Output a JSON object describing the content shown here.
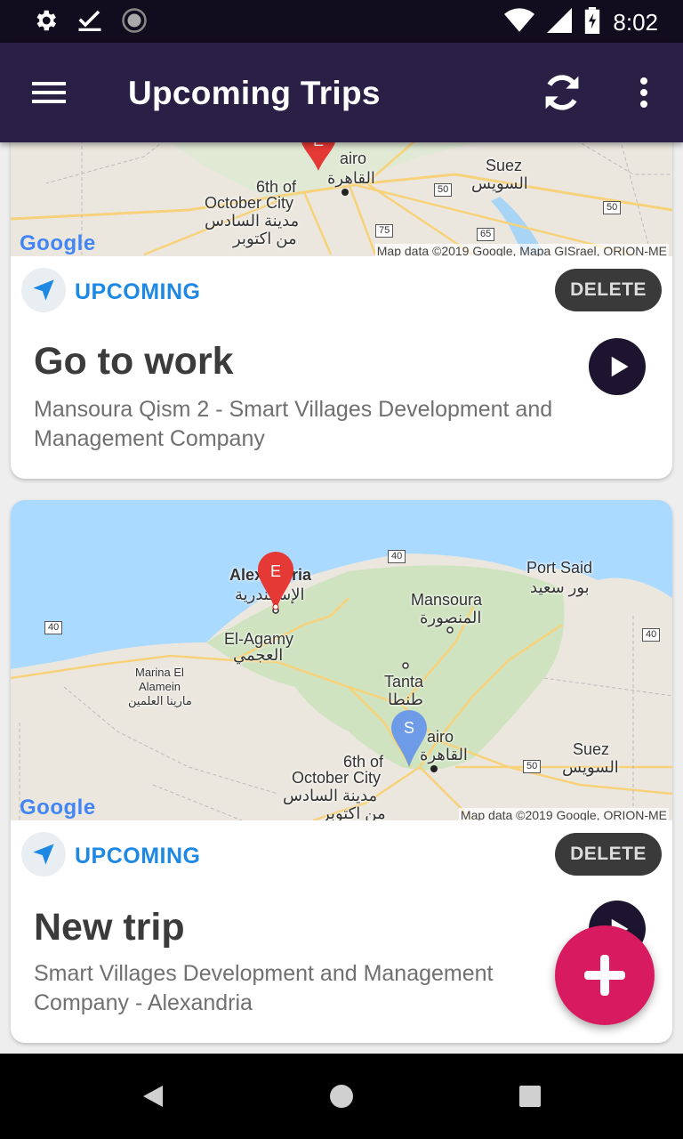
{
  "status_bar": {
    "time": "8:02",
    "left_icons": [
      "gear-icon",
      "check-icon",
      "sync-progress-icon"
    ],
    "right_icons": [
      "wifi-icon",
      "cell-signal-icon",
      "battery-icon"
    ]
  },
  "app_bar": {
    "title": "Upcoming Trips",
    "menu_icon": "hamburger-icon",
    "refresh_icon": "refresh-icon",
    "overflow_icon": "more-vert-icon",
    "background": "#2a1f44"
  },
  "trips": [
    {
      "status": "UPCOMING",
      "delete_label": "DELETE",
      "title": "Go to work",
      "route": "Mansoura Qism 2 - Smart Villages Development and Management Company",
      "map": {
        "google_label": "Google",
        "attribution": "Map data ©2019 Google, Mapa GISrael, ORION-ME",
        "labels": [
          "airo",
          "القاهرة",
          "6th of",
          "October City",
          "مدينة السادس",
          "من اكتوبر",
          "Suez",
          "السويس",
          "50",
          "50",
          "75",
          "65"
        ],
        "marker": "E"
      }
    },
    {
      "status": "UPCOMING",
      "delete_label": "DELETE",
      "title": "New trip",
      "route": "Smart Villages Development and Management Company - Alexandria",
      "map": {
        "google_label": "Google",
        "attribution": "Map data ©2019 Google, ORION-ME",
        "labels": [
          "Alexandria",
          "الإسكندرية",
          "Port Said",
          "بور سعيد",
          "Mansoura",
          "المنصورة",
          "El-Agamy",
          "العجمي",
          "Marina El",
          "Alamein",
          "مارينا العلمين",
          "Tanta",
          "طنطا",
          "airo",
          "القاهرة",
          "6th of",
          "October City",
          "مدينة السادس",
          "من اكتوبر",
          "Suez",
          "السويس",
          "40",
          "40",
          "40",
          "50"
        ],
        "marker_end": "E",
        "marker_start": "S"
      }
    }
  ],
  "fab": {
    "icon": "plus-icon",
    "color": "#d81b60"
  },
  "nav_bar": {
    "icons": [
      "back-icon",
      "home-icon",
      "recents-icon"
    ]
  }
}
